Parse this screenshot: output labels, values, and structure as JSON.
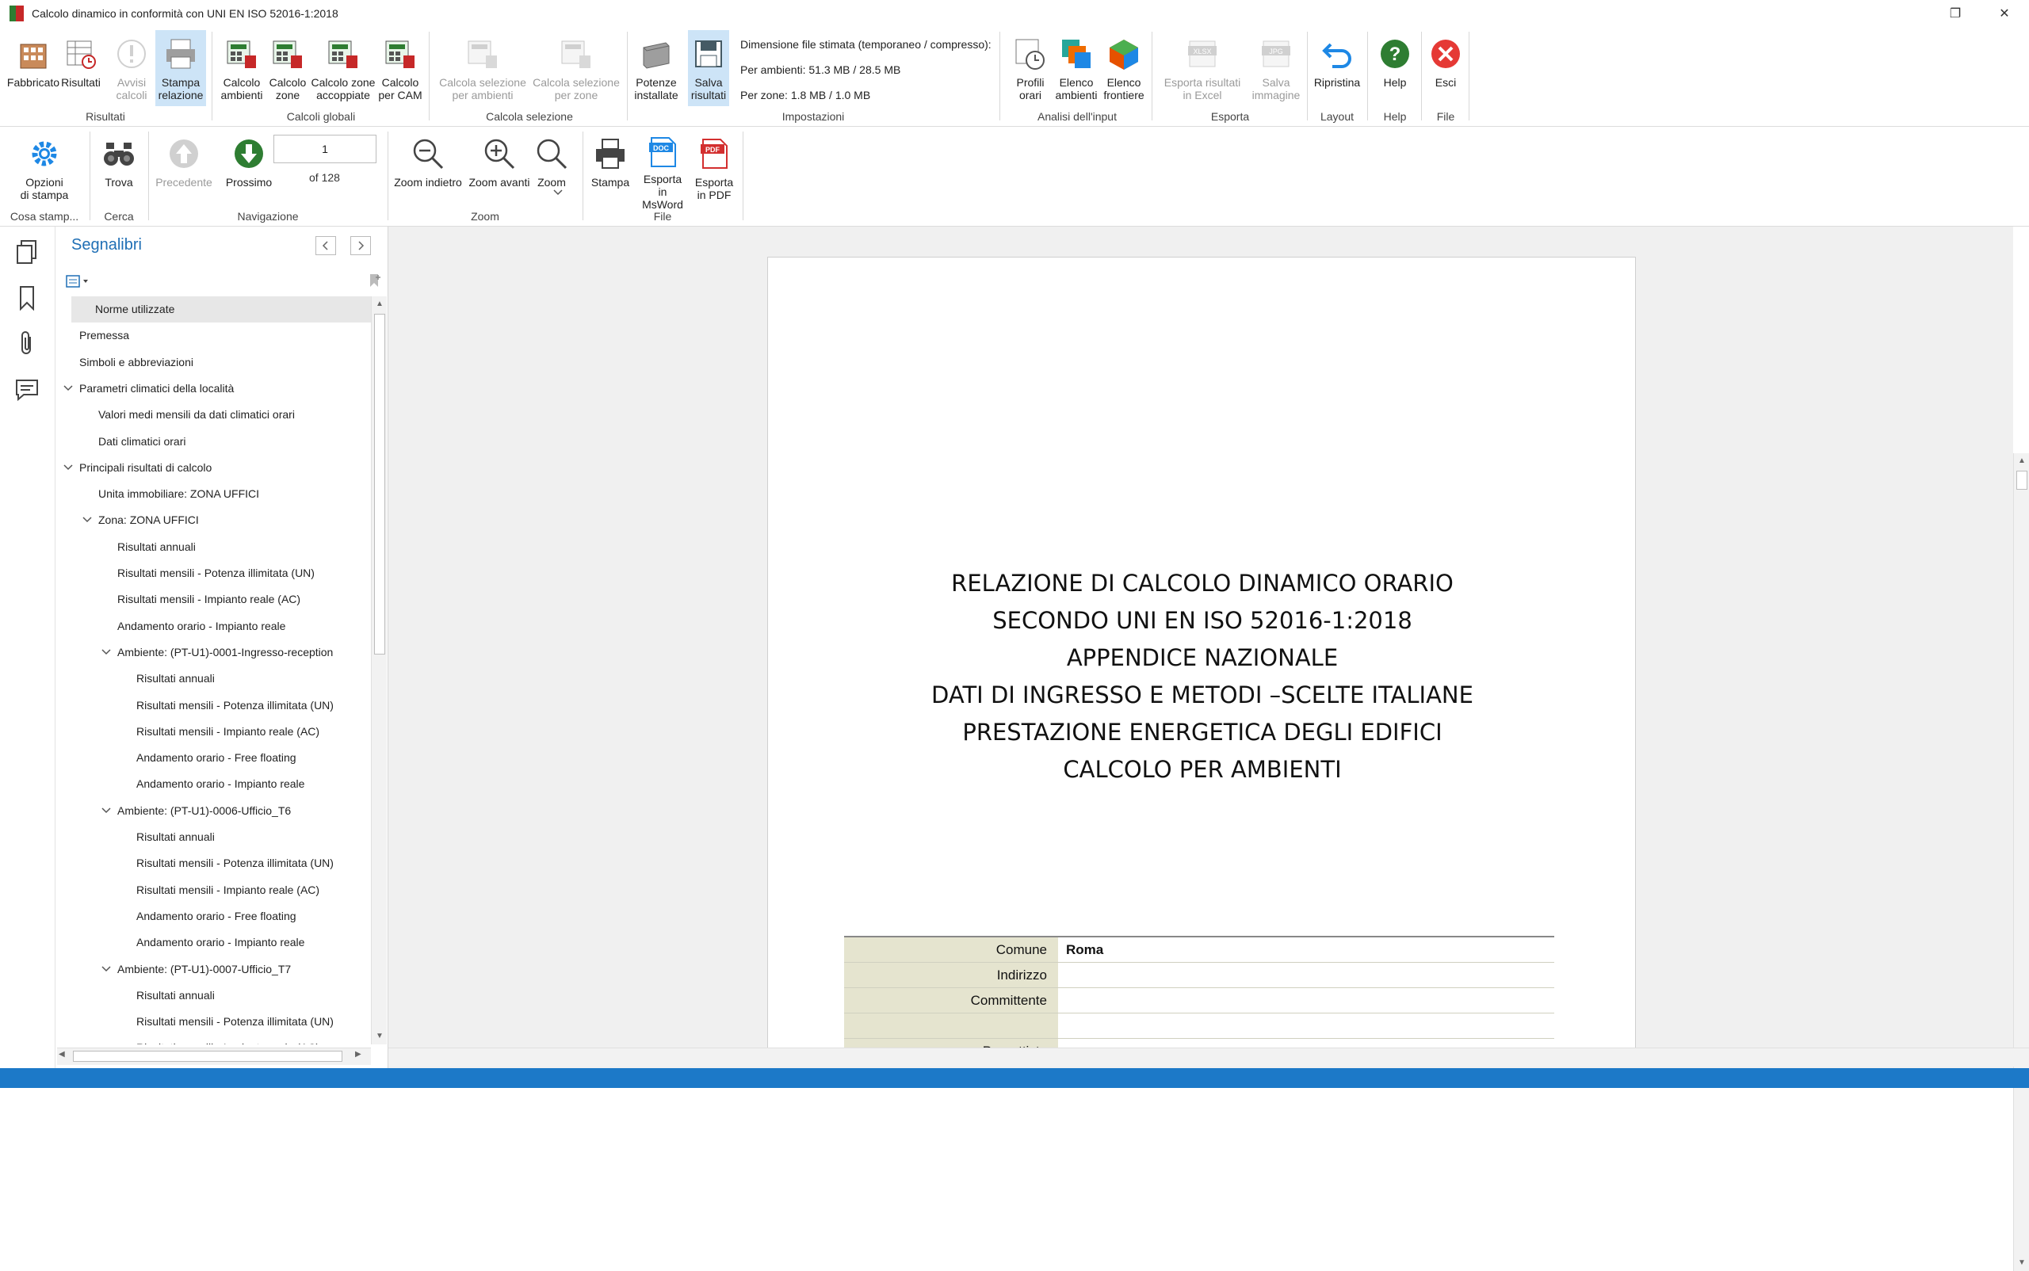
{
  "window": {
    "title": "Calcolo dinamico in conformità con UNI EN ISO 52016-1:2018",
    "restore_glyph": "❐",
    "close_glyph": "✕"
  },
  "ribbon1": {
    "groups": [
      {
        "label": "Risultati",
        "buttons": [
          {
            "label": "Fabbricato",
            "icon": "building-icon"
          },
          {
            "label": "Risultati",
            "icon": "results-table-icon"
          },
          {
            "label": "Avvisi\ncalcoli",
            "icon": "warning-icon",
            "disabled": true
          },
          {
            "label": "Stampa\nrelazione",
            "icon": "print-report-icon",
            "active": true
          }
        ]
      },
      {
        "label": "Calcoli globali",
        "buttons": [
          {
            "label": "Calcolo\nambienti",
            "icon": "calc-rooms-icon"
          },
          {
            "label": "Calcolo\nzone",
            "icon": "calc-zones-icon"
          },
          {
            "label": "Calcolo zone\naccoppiate",
            "icon": "calc-coupled-zones-icon"
          },
          {
            "label": "Calcolo\nper CAM",
            "icon": "calc-cam-icon"
          }
        ]
      },
      {
        "label": "Calcola selezione",
        "buttons": [
          {
            "label": "Calcola selezione\nper ambienti",
            "icon": "calc-selection-rooms-icon",
            "disabled": true
          },
          {
            "label": "Calcola selezione\nper zone",
            "icon": "calc-selection-zones-icon",
            "disabled": true
          }
        ]
      },
      {
        "label": "Impostazioni",
        "buttons": [
          {
            "label": "Potenze\ninstallate",
            "icon": "installed-power-icon"
          },
          {
            "label": "Salva\nrisultati",
            "icon": "save-results-icon",
            "active": true
          }
        ]
      },
      {
        "label": "Analisi dell'input",
        "buttons": [
          {
            "label": "Profili\norari",
            "icon": "hourly-profiles-icon"
          },
          {
            "label": "Elenco\nambienti",
            "icon": "rooms-list-icon"
          },
          {
            "label": "Elenco\nfrontiere",
            "icon": "boundaries-list-icon"
          }
        ]
      },
      {
        "label": "Esporta",
        "buttons": [
          {
            "label": "Esporta risultati\nin Excel",
            "icon": "xlsx-icon",
            "disabled": true
          },
          {
            "label": "Salva\nimmagine",
            "icon": "jpg-icon",
            "disabled": true
          }
        ]
      },
      {
        "label": "Layout",
        "buttons": [
          {
            "label": "Ripristina",
            "icon": "undo-icon"
          }
        ]
      },
      {
        "label": "Help",
        "buttons": [
          {
            "label": "Help",
            "icon": "help-icon"
          }
        ]
      },
      {
        "label": "File",
        "buttons": [
          {
            "label": "Esci",
            "icon": "exit-icon"
          }
        ]
      }
    ],
    "filesize": {
      "title": "Dimensione file stimata (temporaneo / compresso):",
      "per_ambienti": "Per ambienti: 51.3 MB / 28.5 MB",
      "per_zone": "Per zone: 1.8 MB / 1.0 MB"
    }
  },
  "ribbon2": {
    "groups": [
      {
        "label": "Cosa stamp...",
        "buttons": [
          {
            "label": "Opzioni\ndi stampa",
            "icon": "gear-icon"
          }
        ]
      },
      {
        "label": "Cerca",
        "buttons": [
          {
            "label": "Trova",
            "icon": "binoculars-icon"
          }
        ]
      },
      {
        "label": "Navigazione",
        "buttons": [
          {
            "label": "Precedente",
            "icon": "arrow-up-icon",
            "disabled": true
          },
          {
            "label": "Prossimo",
            "icon": "arrow-down-icon"
          }
        ]
      },
      {
        "label": "Zoom",
        "buttons": [
          {
            "label": "Zoom indietro",
            "icon": "zoom-out-icon"
          },
          {
            "label": "Zoom avanti",
            "icon": "zoom-in-icon"
          },
          {
            "label": "Zoom",
            "icon": "zoom-icon"
          }
        ]
      },
      {
        "label": "File",
        "buttons": [
          {
            "label": "Stampa",
            "icon": "printer-icon"
          },
          {
            "label": "Esporta\nin MsWord",
            "icon": "doc-icon"
          },
          {
            "label": "Esporta\nin PDF",
            "icon": "pdf-icon"
          }
        ]
      }
    ],
    "page": {
      "current": "1",
      "of": "of 128"
    }
  },
  "bookmarks": {
    "title": "Segnalibri",
    "items": [
      {
        "label": "Norme utilizzate",
        "level": 0,
        "selected": true
      },
      {
        "label": "Premessa",
        "level": 0
      },
      {
        "label": "Simboli e abbreviazioni",
        "level": 0
      },
      {
        "label": "Parametri climatici della località",
        "level": 0,
        "expanded": true
      },
      {
        "label": "Valori medi mensili da dati climatici orari",
        "level": 1
      },
      {
        "label": "Dati climatici orari",
        "level": 1
      },
      {
        "label": "Principali risultati di calcolo",
        "level": 0,
        "expanded": true
      },
      {
        "label": "Unita immobiliare: ZONA UFFICI",
        "level": 1
      },
      {
        "label": "Zona: ZONA UFFICI",
        "level": 1,
        "expanded": true
      },
      {
        "label": "Risultati annuali",
        "level": 2
      },
      {
        "label": "Risultati mensili - Potenza illimitata (UN)",
        "level": 2
      },
      {
        "label": "Risultati mensili - Impianto reale (AC)",
        "level": 2
      },
      {
        "label": "Andamento orario - Impianto reale",
        "level": 2
      },
      {
        "label": "Ambiente: (PT-U1)-0001-Ingresso-reception",
        "level": 2,
        "expanded": true
      },
      {
        "label": "Risultati annuali",
        "level": 3
      },
      {
        "label": "Risultati mensili - Potenza illimitata (UN)",
        "level": 3
      },
      {
        "label": "Risultati mensili - Impianto reale (AC)",
        "level": 3
      },
      {
        "label": "Andamento orario - Free floating",
        "level": 3
      },
      {
        "label": "Andamento orario - Impianto reale",
        "level": 3
      },
      {
        "label": "Ambiente: (PT-U1)-0006-Ufficio_T6",
        "level": 2,
        "expanded": true
      },
      {
        "label": "Risultati annuali",
        "level": 3
      },
      {
        "label": "Risultati mensili - Potenza illimitata (UN)",
        "level": 3
      },
      {
        "label": "Risultati mensili - Impianto reale (AC)",
        "level": 3
      },
      {
        "label": "Andamento orario - Free floating",
        "level": 3
      },
      {
        "label": "Andamento orario - Impianto reale",
        "level": 3
      },
      {
        "label": "Ambiente: (PT-U1)-0007-Ufficio_T7",
        "level": 2,
        "expanded": true
      },
      {
        "label": "Risultati annuali",
        "level": 3
      },
      {
        "label": "Risultati mensili - Potenza illimitata (UN)",
        "level": 3
      },
      {
        "label": "Risultati mensili - Impianto reale (AC)",
        "level": 3
      }
    ]
  },
  "document": {
    "title_lines": [
      "RELAZIONE DI CALCOLO DINAMICO ORARIO",
      "SECONDO UNI EN ISO 52016-1:2018",
      "APPENDICE NAZIONALE",
      "DATI DI INGRESSO E METODI –SCELTE ITALIANE",
      "PRESTAZIONE ENERGETICA DEGLI EDIFICI",
      "CALCOLO PER AMBIENTI"
    ],
    "table": [
      {
        "key": "Comune",
        "value": "Roma"
      },
      {
        "key": "Indirizzo",
        "value": ""
      },
      {
        "key": "Committente",
        "value": ""
      },
      {
        "key": "",
        "value": ""
      },
      {
        "key": "Progettista",
        "value": ""
      }
    ]
  },
  "colors": {
    "accent": "#1c79c8",
    "active_button": "#cde4f7",
    "table_key_bg": "#e5e4cf"
  }
}
